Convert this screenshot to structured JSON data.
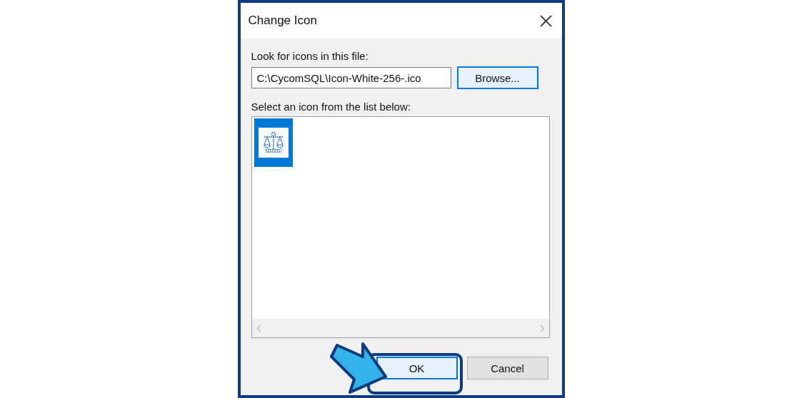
{
  "window": {
    "title": "Change Icon"
  },
  "file": {
    "label": "Look for icons in this file:",
    "value": "C:\\CycomSQL\\Icon-White-256-.ico",
    "browse": "Browse..."
  },
  "icon_list": {
    "label": "Select an icon from the list below:",
    "items": [
      {
        "selected": true
      }
    ]
  },
  "buttons": [
    {
      "label": "OK",
      "default": true
    },
    {
      "label": "Cancel",
      "default": false
    }
  ]
}
